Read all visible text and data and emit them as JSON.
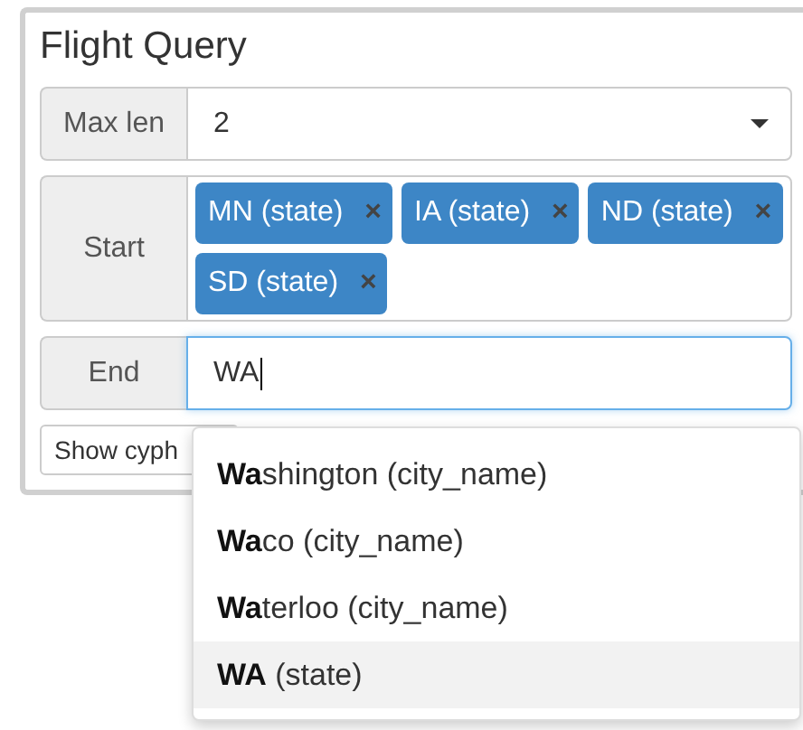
{
  "panel": {
    "title": "Flight Query"
  },
  "fields": [
    {
      "kind": "select",
      "label": "Max len",
      "value": "2"
    },
    {
      "kind": "tags",
      "label": "Start",
      "tags": [
        {
          "text": "MN (state)",
          "remove": "×"
        },
        {
          "text": "IA (state)",
          "remove": "×"
        },
        {
          "text": "ND (state)",
          "remove": "×"
        },
        {
          "text": "SD (state)",
          "remove": "×"
        }
      ]
    },
    {
      "kind": "text",
      "label": "End",
      "value": "WA",
      "focused": true
    }
  ],
  "button": {
    "label": "Show cyph"
  },
  "suggestions": [
    {
      "text": "**Wa**shington (city_name)",
      "selected": false
    },
    {
      "text": "**Wa**co (city_name)",
      "selected": false
    },
    {
      "text": "**Wa**terloo (city_name)",
      "selected": false
    },
    {
      "text": "**WA** (state)",
      "selected": true
    }
  ]
}
